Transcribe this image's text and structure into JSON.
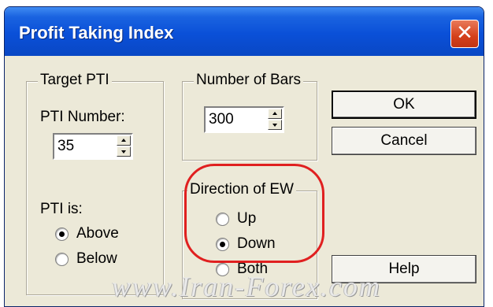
{
  "window": {
    "title": "Profit Taking Index",
    "close_glyph": "✕"
  },
  "target_pti": {
    "group_label": "Target PTI",
    "number_label": "PTI Number:",
    "number_value": "35",
    "is_label": "PTI is:",
    "options": [
      {
        "label": "Above",
        "checked": true
      },
      {
        "label": "Below",
        "checked": false
      }
    ]
  },
  "bars": {
    "group_label": "Number of Bars",
    "value": "300"
  },
  "direction": {
    "group_label": "Direction of EW",
    "options": [
      {
        "label": "Up",
        "checked": false
      },
      {
        "label": "Down",
        "checked": true
      },
      {
        "label": "Both",
        "checked": false
      }
    ]
  },
  "buttons": {
    "ok": "OK",
    "cancel": "Cancel",
    "help": "Help"
  },
  "watermark": "www.Iran-Forex.com",
  "colors": {
    "titlebar": "#0a50d8",
    "dialog_bg": "#ece9d8",
    "annotation": "#e02020"
  }
}
